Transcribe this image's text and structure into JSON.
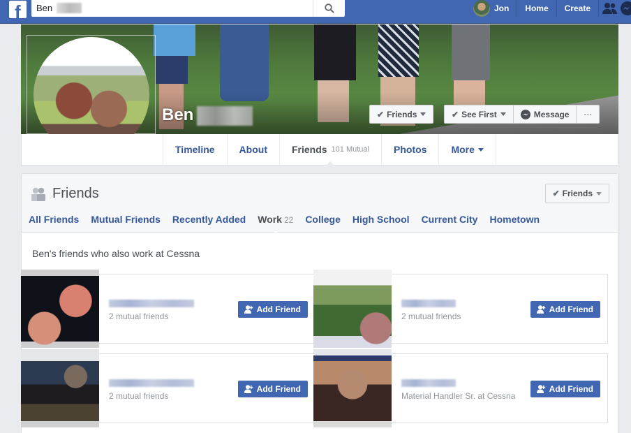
{
  "topbar": {
    "logo": "f",
    "search_value": "Ben",
    "user_name": "Jon",
    "nav": [
      "Home",
      "Create"
    ],
    "icons": [
      "friend-requests-icon",
      "messenger-icon"
    ]
  },
  "profile": {
    "first_name": "Ben",
    "buttons": {
      "friends": "Friends",
      "see_first": "See First",
      "message": "Message",
      "more": "···"
    }
  },
  "timeline_tabs": [
    {
      "label": "Timeline"
    },
    {
      "label": "About"
    },
    {
      "label": "Friends",
      "sub": "101 Mutual",
      "active": true
    },
    {
      "label": "Photos"
    },
    {
      "label": "More"
    }
  ],
  "friends_section": {
    "title": "Friends",
    "toggle_label": "Friends",
    "subtabs": [
      {
        "label": "All Friends"
      },
      {
        "label": "Mutual Friends"
      },
      {
        "label": "Recently Added"
      },
      {
        "label": "Work",
        "count": "22",
        "active": true
      },
      {
        "label": "College"
      },
      {
        "label": "High School"
      },
      {
        "label": "Current City"
      },
      {
        "label": "Hometown"
      }
    ],
    "description": "Ben's friends who also work at Cessna",
    "cards": [
      {
        "subtitle": "2 mutual friends",
        "button": "Add Friend"
      },
      {
        "subtitle": "2 mutual friends",
        "button": "Add Friend"
      },
      {
        "subtitle": "2 mutual friends",
        "button": "Add Friend"
      },
      {
        "subtitle": "Material Handler Sr. at Cessna",
        "button": "Add Friend"
      }
    ]
  },
  "colors": {
    "brand": "#4267b2",
    "link": "#365899",
    "page_bg": "#e9ebee"
  }
}
